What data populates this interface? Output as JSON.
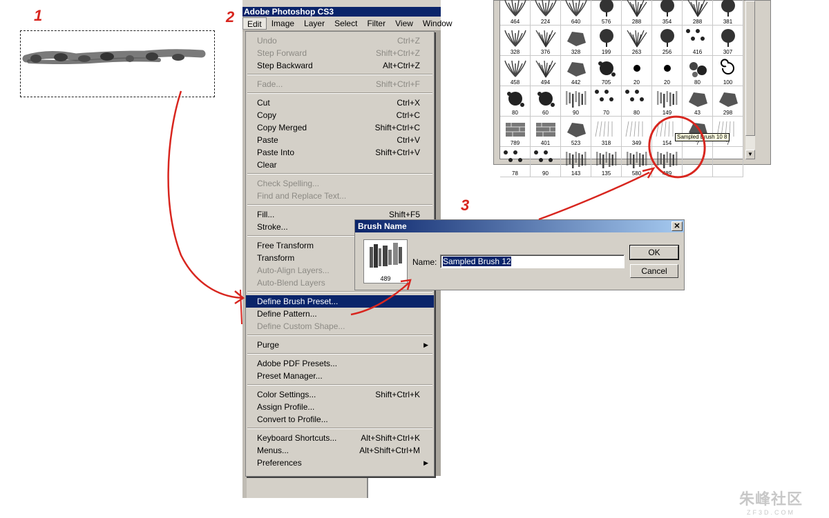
{
  "steps": [
    "1",
    "2",
    "3"
  ],
  "photoshop": {
    "title": "Adobe Photoshop CS3",
    "menubar": [
      "Edit",
      "Image",
      "Layer",
      "Select",
      "Filter",
      "View",
      "Window"
    ],
    "edit_menu": [
      {
        "label": "Undo",
        "shortcut": "Ctrl+Z",
        "disabled": true
      },
      {
        "label": "Step Forward",
        "shortcut": "Shift+Ctrl+Z",
        "disabled": true
      },
      {
        "label": "Step Backward",
        "shortcut": "Alt+Ctrl+Z",
        "disabled": false
      },
      {
        "sep": true
      },
      {
        "label": "Fade...",
        "shortcut": "Shift+Ctrl+F",
        "disabled": true
      },
      {
        "sep": true
      },
      {
        "label": "Cut",
        "shortcut": "Ctrl+X",
        "disabled": false
      },
      {
        "label": "Copy",
        "shortcut": "Ctrl+C",
        "disabled": false
      },
      {
        "label": "Copy Merged",
        "shortcut": "Shift+Ctrl+C",
        "disabled": false
      },
      {
        "label": "Paste",
        "shortcut": "Ctrl+V",
        "disabled": false
      },
      {
        "label": "Paste Into",
        "shortcut": "Shift+Ctrl+V",
        "disabled": false
      },
      {
        "label": "Clear",
        "shortcut": "",
        "disabled": false
      },
      {
        "sep": true
      },
      {
        "label": "Check Spelling...",
        "shortcut": "",
        "disabled": true
      },
      {
        "label": "Find and Replace Text...",
        "shortcut": "",
        "disabled": true
      },
      {
        "sep": true
      },
      {
        "label": "Fill...",
        "shortcut": "Shift+F5",
        "disabled": false
      },
      {
        "label": "Stroke...",
        "shortcut": "",
        "disabled": false
      },
      {
        "sep": true
      },
      {
        "label": "Free Transform",
        "shortcut": "",
        "disabled": false
      },
      {
        "label": "Transform",
        "shortcut": "",
        "disabled": false
      },
      {
        "label": "Auto-Align Layers...",
        "shortcut": "",
        "disabled": true
      },
      {
        "label": "Auto-Blend Layers",
        "shortcut": "",
        "disabled": true
      },
      {
        "sep": true
      },
      {
        "label": "Define Brush Preset...",
        "shortcut": "",
        "disabled": false,
        "selected": true
      },
      {
        "label": "Define Pattern...",
        "shortcut": "",
        "disabled": false
      },
      {
        "label": "Define Custom Shape...",
        "shortcut": "",
        "disabled": true
      },
      {
        "sep": true
      },
      {
        "label": "Purge",
        "shortcut": "",
        "disabled": false,
        "submenu": true
      },
      {
        "sep": true
      },
      {
        "label": "Adobe PDF Presets...",
        "shortcut": "",
        "disabled": false
      },
      {
        "label": "Preset Manager...",
        "shortcut": "",
        "disabled": false
      },
      {
        "sep": true
      },
      {
        "label": "Color Settings...",
        "shortcut": "Shift+Ctrl+K",
        "disabled": false
      },
      {
        "label": "Assign Profile...",
        "shortcut": "",
        "disabled": false
      },
      {
        "label": "Convert to Profile...",
        "shortcut": "",
        "disabled": false
      },
      {
        "sep": true
      },
      {
        "label": "Keyboard Shortcuts...",
        "shortcut": "Alt+Shift+Ctrl+K",
        "disabled": false
      },
      {
        "label": "Menus...",
        "shortcut": "Alt+Shift+Ctrl+M",
        "disabled": false
      },
      {
        "label": "Preferences",
        "shortcut": "",
        "disabled": false,
        "submenu": true
      }
    ]
  },
  "dialog": {
    "title": "Brush Name",
    "close": "✕",
    "thumb_size": "489",
    "name_label": "Name:",
    "name_value": "Sampled Brush 12",
    "ok_label": "OK",
    "cancel_label": "Cancel"
  },
  "brush_panel": {
    "rows": [
      [
        "464",
        "224",
        "640",
        "576",
        "288",
        "354",
        "288",
        "381"
      ],
      [
        "328",
        "376",
        "328",
        "199",
        "263",
        "256",
        "416",
        "307"
      ],
      [
        "458",
        "494",
        "442",
        "705",
        "20",
        "20",
        "80",
        "100"
      ],
      [
        "80",
        "60",
        "90",
        "70",
        "80",
        "149",
        "43",
        "298"
      ],
      [
        "789",
        "401",
        "523",
        "318",
        "349",
        "154",
        "?",
        "?"
      ],
      [
        "78",
        "90",
        "143",
        "135",
        "580",
        "489",
        "",
        ""
      ]
    ],
    "tooltip": "Sampled Brush 10 8"
  },
  "watermark": {
    "brand": "朱峰社区",
    "domain": "ZF3D.COM"
  },
  "colors": {
    "annotation_red": "#d8261f",
    "menu_highlight": "#0a246a",
    "chrome": "#d4d0c8"
  }
}
